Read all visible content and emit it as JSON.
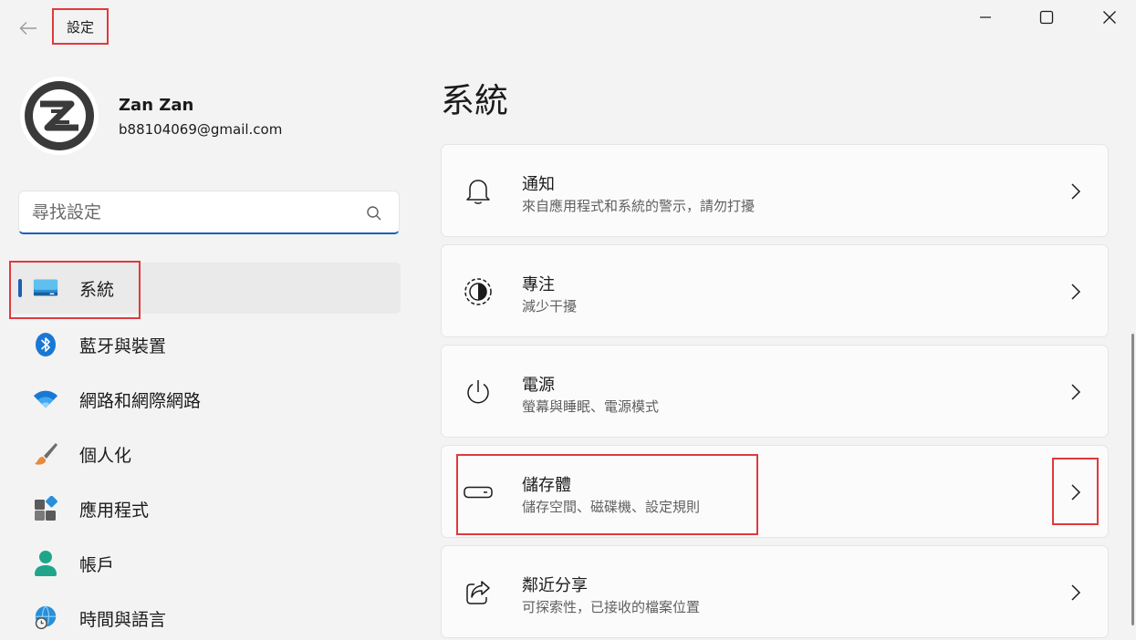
{
  "app": {
    "title": "設定"
  },
  "user": {
    "name": "Zan Zan",
    "email": "b88104069@gmail.com"
  },
  "search": {
    "placeholder": "尋找設定"
  },
  "nav": {
    "items": [
      {
        "label": "系統",
        "icon": "system-display-icon",
        "active": true
      },
      {
        "label": "藍牙與裝置",
        "icon": "bluetooth-icon"
      },
      {
        "label": "網路和網際網路",
        "icon": "wifi-icon"
      },
      {
        "label": "個人化",
        "icon": "paintbrush-icon"
      },
      {
        "label": "應用程式",
        "icon": "apps-icon"
      },
      {
        "label": "帳戶",
        "icon": "person-icon"
      },
      {
        "label": "時間與語言",
        "icon": "globe-clock-icon"
      }
    ]
  },
  "page": {
    "title": "系統"
  },
  "cards": [
    {
      "title": "通知",
      "subtitle": "來自應用程式和系統的警示，請勿打擾",
      "icon": "bell-icon"
    },
    {
      "title": "專注",
      "subtitle": "減少干擾",
      "icon": "focus-icon"
    },
    {
      "title": "電源",
      "subtitle": "螢幕與睡眠、電源模式",
      "icon": "power-icon"
    },
    {
      "title": "儲存體",
      "subtitle": "儲存空間、磁碟機、設定規則",
      "icon": "storage-drive-icon"
    },
    {
      "title": "鄰近分享",
      "subtitle": "可探索性，已接收的檔案位置",
      "icon": "share-icon"
    }
  ],
  "colors": {
    "accent": "#1a60b5",
    "highlight": "#e0393e",
    "background": "#f3f3f3",
    "card": "#fbfbfb"
  }
}
